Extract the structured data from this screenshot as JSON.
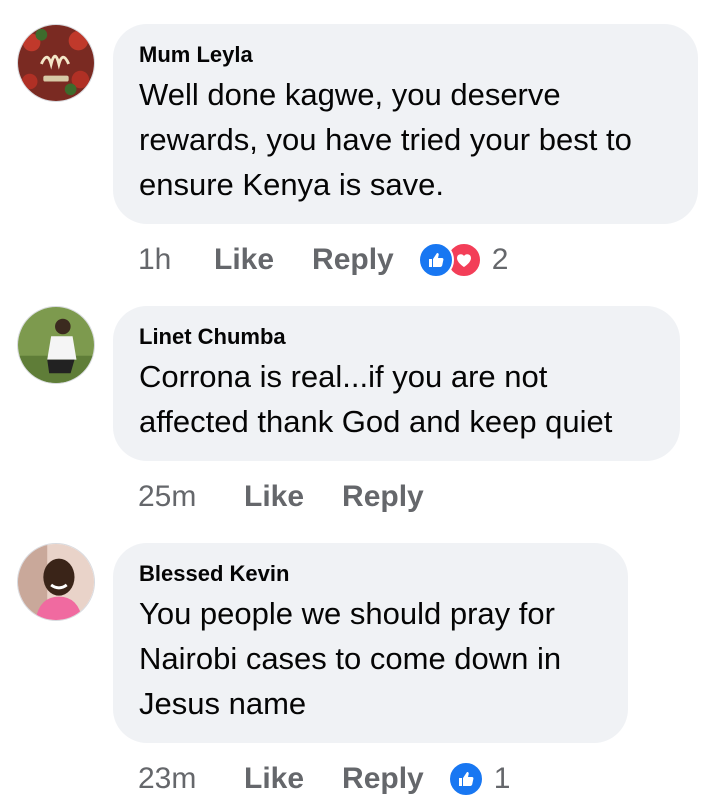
{
  "comments": [
    {
      "author": "Mum Leyla",
      "text": "Well done kagwe, you deserve\nrewards, you have tried your best to\nensure Kenya is save.",
      "time": "1h",
      "like_label": "Like",
      "reply_label": "Reply",
      "reactions": [
        "like-icon",
        "love-icon"
      ],
      "reaction_count": "2"
    },
    {
      "author": "Linet Chumba",
      "text": "Corrona is real...if you are not\naffected thank God and keep quiet",
      "time": "25m",
      "like_label": "Like",
      "reply_label": "Reply"
    },
    {
      "author": "Blessed Kevin",
      "text": "You people we should pray for\nNairobi cases to come down in\nJesus name",
      "time": "23m",
      "like_label": "Like",
      "reply_label": "Reply",
      "reactions": [
        "like-icon"
      ],
      "reaction_count": "1"
    }
  ],
  "colors": {
    "bubble": "#f0f2f5",
    "meta_text": "#65676b",
    "like_blue": "#1877f2",
    "love_red": "#f33e58"
  }
}
